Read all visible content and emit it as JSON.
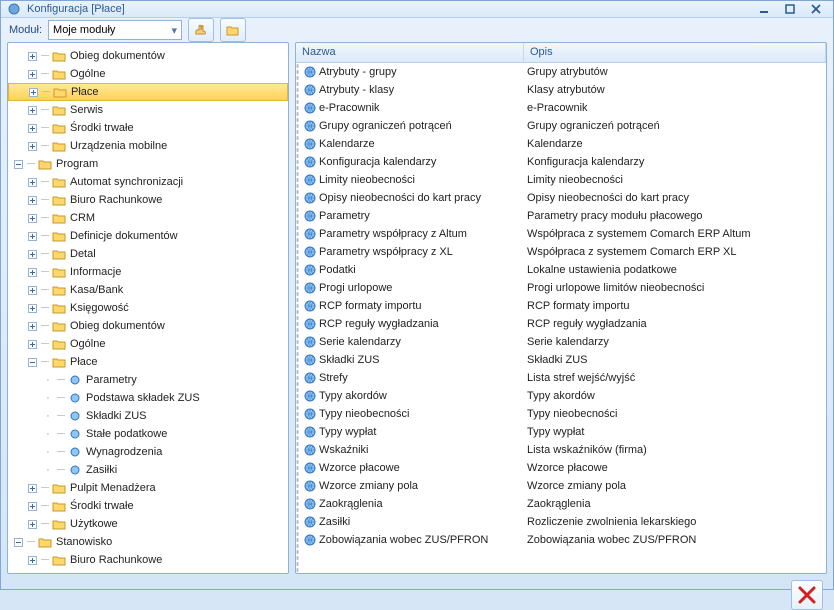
{
  "window": {
    "title": "Konfiguracja [Płace]"
  },
  "toolbar": {
    "module_label": "Moduł:",
    "module_value": "Moje moduły"
  },
  "grid": {
    "columns": {
      "name": "Nazwa",
      "desc": "Opis"
    },
    "rows": [
      {
        "name": "Atrybuty - grupy",
        "desc": "Grupy atrybutów"
      },
      {
        "name": "Atrybuty - klasy",
        "desc": "Klasy atrybutów"
      },
      {
        "name": "e-Pracownik",
        "desc": "e-Pracownik"
      },
      {
        "name": "Grupy ograniczeń potrąceń",
        "desc": "Grupy ograniczeń potrąceń"
      },
      {
        "name": "Kalendarze",
        "desc": "Kalendarze"
      },
      {
        "name": "Konfiguracja kalendarzy",
        "desc": "Konfiguracja kalendarzy"
      },
      {
        "name": "Limity nieobecności",
        "desc": "Limity nieobecności"
      },
      {
        "name": "Opisy nieobecności do kart pracy",
        "desc": "Opisy nieobecności do kart pracy"
      },
      {
        "name": "Parametry",
        "desc": "Parametry pracy modułu płacowego"
      },
      {
        "name": "Parametry współpracy z Altum",
        "desc": "Współpraca z systemem Comarch ERP Altum"
      },
      {
        "name": "Parametry współpracy z XL",
        "desc": "Współpraca z systemem Comarch ERP XL"
      },
      {
        "name": "Podatki",
        "desc": "Lokalne ustawienia podatkowe"
      },
      {
        "name": "Progi urlopowe",
        "desc": "Progi urlopowe limitów nieobecności"
      },
      {
        "name": "RCP formaty importu",
        "desc": "RCP formaty importu"
      },
      {
        "name": "RCP reguły wygładzania",
        "desc": "RCP reguły wygładzania"
      },
      {
        "name": "Serie kalendarzy",
        "desc": "Serie kalendarzy"
      },
      {
        "name": "Składki ZUS",
        "desc": "Składki ZUS"
      },
      {
        "name": "Strefy",
        "desc": "Lista stref wejść/wyjść"
      },
      {
        "name": "Typy akordów",
        "desc": "Typy akordów"
      },
      {
        "name": "Typy nieobecności",
        "desc": "Typy nieobecności"
      },
      {
        "name": "Typy wypłat",
        "desc": "Typy wypłat"
      },
      {
        "name": "Wskaźniki",
        "desc": "Lista wskaźników (firma)"
      },
      {
        "name": "Wzorce płacowe",
        "desc": "Wzorce płacowe"
      },
      {
        "name": "Wzorce zmiany pola",
        "desc": "Wzorce zmiany pola"
      },
      {
        "name": "Zaokrąglenia",
        "desc": "Zaokrąglenia"
      },
      {
        "name": "Zasiłki",
        "desc": "Rozliczenie zwolnienia lekarskiego"
      },
      {
        "name": "Zobowiązania wobec ZUS/PFRON",
        "desc": "Zobowiązania wobec ZUS/PFRON"
      }
    ]
  },
  "tree": [
    {
      "level": 1,
      "toggle": "+",
      "kind": "folder",
      "label": "Obieg dokumentów"
    },
    {
      "level": 1,
      "toggle": "+",
      "kind": "folder",
      "label": "Ogólne"
    },
    {
      "level": 1,
      "toggle": "+",
      "kind": "folder",
      "label": "Płace",
      "selected": true
    },
    {
      "level": 1,
      "toggle": "+",
      "kind": "folder",
      "label": "Serwis"
    },
    {
      "level": 1,
      "toggle": "+",
      "kind": "folder",
      "label": "Środki trwałe"
    },
    {
      "level": 1,
      "toggle": "+",
      "kind": "folder",
      "label": "Urządzenia mobilne"
    },
    {
      "level": 0,
      "toggle": "-",
      "kind": "folder",
      "label": "Program"
    },
    {
      "level": 1,
      "toggle": "+",
      "kind": "folder",
      "label": "Automat synchronizacji"
    },
    {
      "level": 1,
      "toggle": "+",
      "kind": "folder",
      "label": "Biuro Rachunkowe"
    },
    {
      "level": 1,
      "toggle": "+",
      "kind": "folder",
      "label": "CRM"
    },
    {
      "level": 1,
      "toggle": "+",
      "kind": "folder",
      "label": "Definicje dokumentów"
    },
    {
      "level": 1,
      "toggle": "+",
      "kind": "folder",
      "label": "Detal"
    },
    {
      "level": 1,
      "toggle": "+",
      "kind": "folder",
      "label": "Informacje"
    },
    {
      "level": 1,
      "toggle": "+",
      "kind": "folder",
      "label": "Kasa/Bank"
    },
    {
      "level": 1,
      "toggle": "+",
      "kind": "folder",
      "label": "Księgowość"
    },
    {
      "level": 1,
      "toggle": "+",
      "kind": "folder",
      "label": "Obieg dokumentów"
    },
    {
      "level": 1,
      "toggle": "+",
      "kind": "folder",
      "label": "Ogólne"
    },
    {
      "level": 1,
      "toggle": "-",
      "kind": "folder",
      "label": "Płace"
    },
    {
      "level": 2,
      "toggle": "",
      "kind": "leaf",
      "label": "Parametry"
    },
    {
      "level": 2,
      "toggle": "",
      "kind": "leaf",
      "label": "Podstawa składek ZUS"
    },
    {
      "level": 2,
      "toggle": "",
      "kind": "leaf",
      "label": "Składki ZUS"
    },
    {
      "level": 2,
      "toggle": "",
      "kind": "leaf",
      "label": "Stałe podatkowe"
    },
    {
      "level": 2,
      "toggle": "",
      "kind": "leaf",
      "label": "Wynagrodzenia"
    },
    {
      "level": 2,
      "toggle": "",
      "kind": "leaf",
      "label": "Zasiłki"
    },
    {
      "level": 1,
      "toggle": "+",
      "kind": "folder",
      "label": "Pulpit Menadżera"
    },
    {
      "level": 1,
      "toggle": "+",
      "kind": "folder",
      "label": "Środki trwałe"
    },
    {
      "level": 1,
      "toggle": "+",
      "kind": "folder",
      "label": "Użytkowe"
    },
    {
      "level": 0,
      "toggle": "-",
      "kind": "folder",
      "label": "Stanowisko"
    },
    {
      "level": 1,
      "toggle": "+",
      "kind": "folder",
      "label": "Biuro Rachunkowe"
    }
  ]
}
